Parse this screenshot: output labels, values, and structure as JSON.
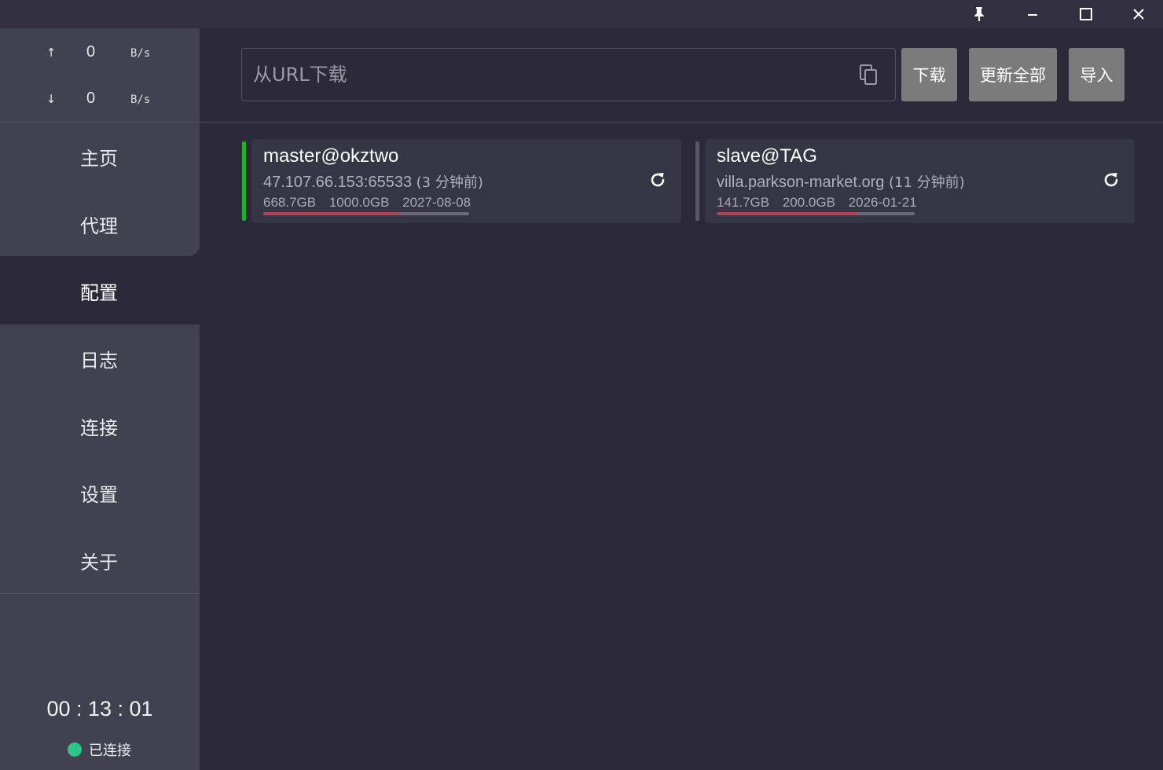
{
  "titlebar": {
    "pin_icon": "pin-icon",
    "minimize_icon": "minimize-icon",
    "maximize_icon": "maximize-icon",
    "close_icon": "close-icon"
  },
  "traffic": {
    "upload": {
      "arrow": "↑",
      "value": "0",
      "unit": "B/s"
    },
    "download": {
      "arrow": "↓",
      "value": "0",
      "unit": "B/s"
    }
  },
  "nav": {
    "items": [
      {
        "label": "主页"
      },
      {
        "label": "代理"
      },
      {
        "label": "配置"
      },
      {
        "label": "日志"
      },
      {
        "label": "连接"
      },
      {
        "label": "设置"
      },
      {
        "label": "关于"
      }
    ],
    "active": "配置"
  },
  "status": {
    "timer": "00 : 13 : 01",
    "label": "已连接",
    "dot_color": "#2fc48a"
  },
  "toolbar": {
    "url_placeholder": "从URL下载",
    "url_value": "",
    "download_label": "下载",
    "update_all_label": "更新全部",
    "import_label": "导入"
  },
  "profiles": [
    {
      "name": "master@okztwo",
      "address": "47.107.66.153:65533",
      "updated": "(3 分钟前)",
      "used": "668.7GB",
      "total": "1000.0GB",
      "expire": "2027-08-08",
      "usage_fraction": 0.669,
      "selected": true,
      "indicator_color": "#12b82a"
    },
    {
      "name": "slave@TAG",
      "address": "villa.parkson-market.org",
      "updated": "(11 分钟前)",
      "used": "141.7GB",
      "total": "200.0GB",
      "expire": "2026-01-21",
      "usage_fraction": 0.709,
      "selected": false,
      "indicator_color": "#5a5966"
    }
  ],
  "colors": {
    "background": "#2c2a38",
    "sidebar": "#42414f",
    "card": "#363544",
    "button": "#7b7b7b",
    "usage_bar": "#9c4c57"
  }
}
